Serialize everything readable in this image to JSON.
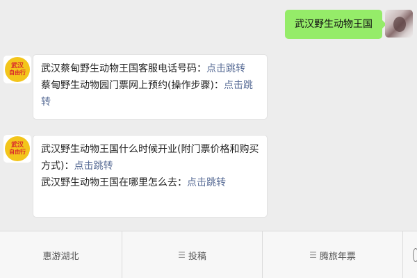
{
  "chat": {
    "user_message": "武汉野生动物王国",
    "bot_messages": [
      {
        "lines": [
          {
            "text": "武汉蔡甸野生动物王国客服电话号码：",
            "link": "点击跳转"
          },
          {
            "text": "蔡甸野生动物园门票网上预约(操作步骤)：",
            "link": "点击跳转"
          }
        ]
      },
      {
        "lines": [
          {
            "text": "武汉野生动物王国什么时候开业(附门票价格和购买",
            "link": ""
          },
          {
            "text": "方式)：",
            "link": "点击跳转"
          },
          {
            "text": "武汉野生动物王国在哪里怎么去：",
            "link": "点击跳转"
          }
        ]
      }
    ],
    "bot_avatar": {
      "line1": "武汉",
      "line2": "自由行"
    }
  },
  "menu": {
    "items": [
      {
        "label": "惠游湖北",
        "icon": ""
      },
      {
        "label": "投稿",
        "icon": "menu-lines-icon"
      },
      {
        "label": "腾旅年票",
        "icon": "menu-lines-icon"
      }
    ],
    "keyboard_icon": "keyboard-toggle-icon"
  },
  "colors": {
    "background": "#ededed",
    "user_bubble": "#95ec69",
    "link": "#576b95",
    "avatar_yellow": "#f3c51b",
    "avatar_red": "#d9262c"
  }
}
